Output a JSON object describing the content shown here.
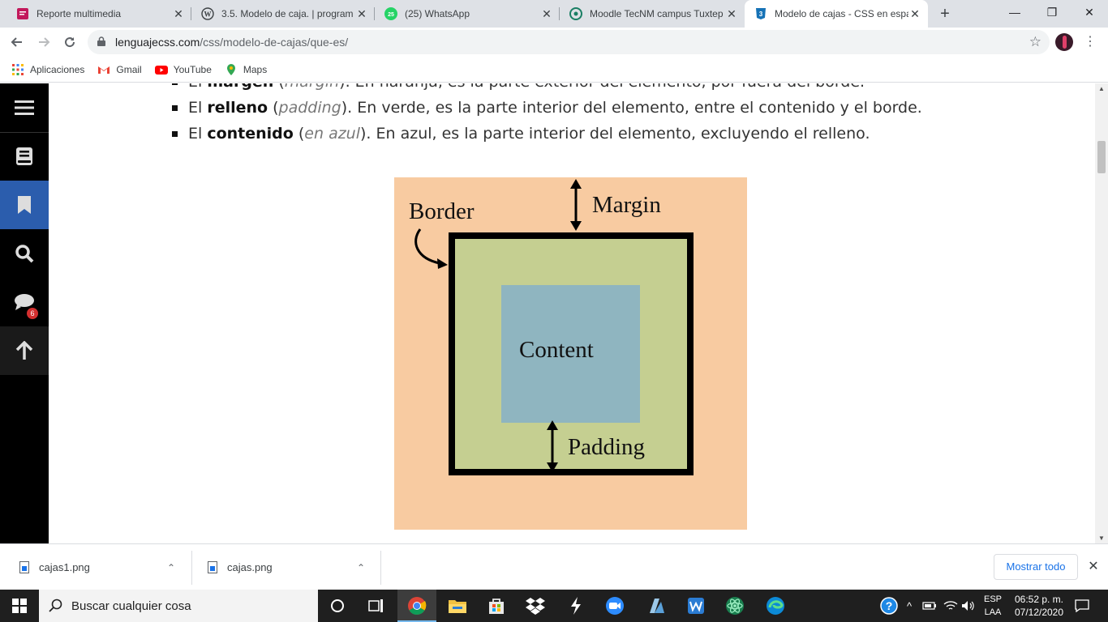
{
  "browser": {
    "tabs": [
      {
        "title": "Reporte multimedia",
        "icon": "pink-doc-icon",
        "active": false
      },
      {
        "title": "3.5. Modelo de caja. | program",
        "icon": "wordpress-icon",
        "active": false
      },
      {
        "title": "(25) WhatsApp",
        "icon": "whatsapp-icon",
        "active": false,
        "badge": "25"
      },
      {
        "title": "Moodle TecNM campus Tuxtep",
        "icon": "moodle-icon",
        "active": false
      },
      {
        "title": "Modelo de cajas - CSS en espa",
        "icon": "css3-icon",
        "active": true
      }
    ],
    "new_tab": "+",
    "window_controls": {
      "minimize": "—",
      "restore": "❐",
      "close": "✕"
    },
    "url_domain": "lenguajecss.com",
    "url_path": "/css/modelo-de-cajas/que-es/",
    "bookmarks": [
      {
        "label": "Aplicaciones",
        "icon": "apps-grid-icon"
      },
      {
        "label": "Gmail",
        "icon": "gmail-icon"
      },
      {
        "label": "YouTube",
        "icon": "youtube-icon"
      },
      {
        "label": "Maps",
        "icon": "maps-pin-icon"
      }
    ]
  },
  "sidebar": {
    "items": [
      {
        "name": "menu",
        "icon": "hamburger-menu-icon"
      },
      {
        "name": "book",
        "icon": "book-icon"
      },
      {
        "name": "bookmark",
        "icon": "bookmark-icon",
        "active": true
      },
      {
        "name": "search",
        "icon": "search-icon"
      },
      {
        "name": "comments",
        "icon": "chat-bubble-icon",
        "badge": "6"
      },
      {
        "name": "top",
        "icon": "arrow-up-icon"
      }
    ]
  },
  "article": {
    "bullets": [
      {
        "lead": "El ",
        "bold": "margen",
        "open": " (",
        "italic": "margin",
        "rest": "). En naranja, es la parte exterior del elemento, por fuera del borde."
      },
      {
        "lead": "El ",
        "bold": "relleno",
        "open": " (",
        "italic": "padding",
        "rest": "). En verde, es la parte interior del elemento, entre el contenido y el borde."
      },
      {
        "lead": "El ",
        "bold": "contenido",
        "open": " (",
        "italic": "en azul",
        "rest": "). En azul, es la parte interior del elemento, excluyendo el relleno."
      }
    ],
    "figure": {
      "labels": {
        "border": "Border",
        "margin": "Margin",
        "content": "Content",
        "padding": "Padding"
      },
      "colors": {
        "margin": "#f8cba1",
        "padding": "#c5cf91",
        "content": "#8fb5c0",
        "border": "#000000"
      }
    }
  },
  "downloads": {
    "items": [
      {
        "filename": "cajas1.png"
      },
      {
        "filename": "cajas.png"
      }
    ],
    "show_all": "Mostrar todo",
    "close": "✕"
  },
  "taskbar": {
    "search_placeholder": "Buscar cualquier cosa",
    "apps": [
      "cortana-circle-icon",
      "task-view-icon",
      "chrome-icon",
      "file-explorer-icon",
      "store-icon",
      "dropbox-icon",
      "bolt-icon",
      "zoom-icon",
      "azure-icon",
      "wps-icon",
      "atom-icon",
      "edge-icon"
    ],
    "lang_line1": "ESP",
    "lang_line2": "LAA",
    "time": "06:52 p. m.",
    "date": "07/12/2020"
  }
}
